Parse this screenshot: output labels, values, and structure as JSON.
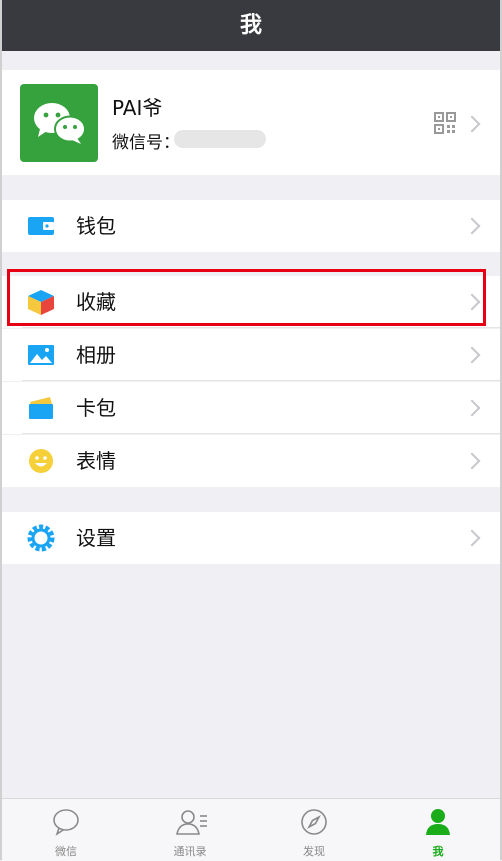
{
  "header": {
    "title": "我"
  },
  "profile": {
    "nickname": "PAI爷",
    "wechat_id_label": "微信号：",
    "qr_icon": "qr-code-icon"
  },
  "menu": {
    "wallet": {
      "label": "钱包",
      "icon": "wallet-icon"
    },
    "favorites": {
      "label": "收藏",
      "icon": "favorites-cube-icon"
    },
    "album": {
      "label": "相册",
      "icon": "album-icon"
    },
    "cards": {
      "label": "卡包",
      "icon": "card-wallet-icon"
    },
    "stickers": {
      "label": "表情",
      "icon": "emoji-icon"
    },
    "settings": {
      "label": "设置",
      "icon": "gear-icon"
    }
  },
  "tabbar": {
    "tabs": [
      {
        "label": "微信",
        "icon": "chat-icon",
        "active": false
      },
      {
        "label": "通讯录",
        "icon": "contacts-icon",
        "active": false
      },
      {
        "label": "发现",
        "icon": "compass-icon",
        "active": false
      },
      {
        "label": "我",
        "icon": "person-icon",
        "active": true
      }
    ]
  },
  "colors": {
    "header_bg": "#393a3f",
    "accent_green": "#1aad19",
    "highlight_red": "#e60012",
    "icon_blue": "#1aa4f4"
  }
}
